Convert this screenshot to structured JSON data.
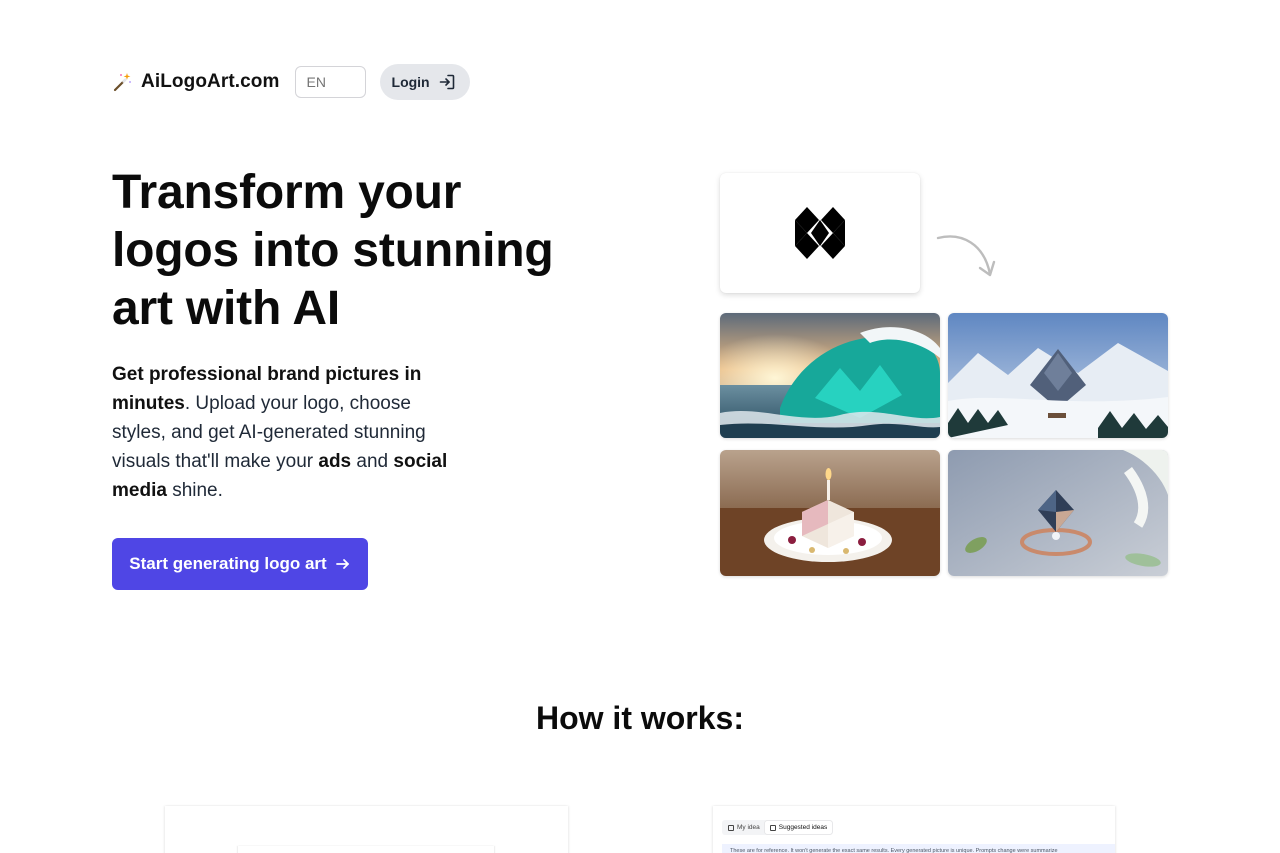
{
  "header": {
    "brand_icon": "magic-wand-icon",
    "brand_name": "AiLogoArt.com",
    "language_placeholder": "EN",
    "login_label": "Login",
    "login_icon": "login-arrow-icon"
  },
  "hero": {
    "title": "Transform your logos into stunning art with AI",
    "description": {
      "part1_bold": "Get professional brand pictures in minutes",
      "part2": ". Upload your logo, choose styles, and get AI-generated stunning visuals that'll make your ",
      "part3_bold": "ads",
      "part4": " and ",
      "part5_bold": "social media",
      "part6": " shine."
    },
    "cta_label": "Start generating logo art",
    "cta_icon": "arrow-right-icon"
  },
  "gallery": {
    "source_logo_icon": "diamond-logo-icon",
    "arrow_icon": "curved-arrow-icon",
    "images": [
      "ocean-wave-logo-art",
      "snowy-mountain-logo-art",
      "birthday-cake-logo-art",
      "jewelry-ring-logo-art"
    ]
  },
  "how_it_works": {
    "title": "How it works:",
    "tabs": [
      "My idea",
      "Suggested ideas"
    ],
    "notice": "These are for reference. It won't generate the exact same results. Every generated picture is unique. Prompts change were summarize"
  },
  "colors": {
    "accent": "#4f46e5",
    "login_bg": "#e5e7eb",
    "text": "#111111"
  }
}
